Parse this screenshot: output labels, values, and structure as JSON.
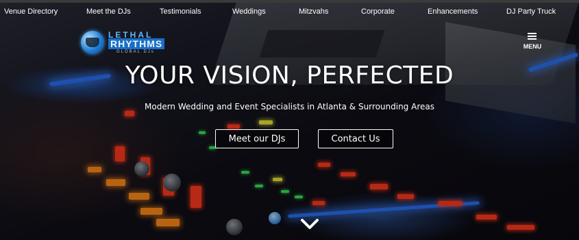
{
  "nav": {
    "items": [
      "Venue Directory",
      "Meet the DJs",
      "Testimonials",
      "Weddings",
      "Mitzvahs",
      "Corporate",
      "Enhancements",
      "DJ Party Truck"
    ]
  },
  "logo": {
    "line1": "LETHAL",
    "line2": "RHYTHMS",
    "line3": "GLOBAL DJs"
  },
  "menu": {
    "label": "MENU",
    "icon": "hamburger-icon"
  },
  "hero": {
    "headline": "YOUR VISION, PERFECTED",
    "subheadline": "Modern Wedding and Event Specialists in Atlanta & Surrounding Areas",
    "buttons": {
      "primary": "Meet our DJs",
      "secondary": "Contact Us"
    },
    "scroll_icon": "chevron-down-icon"
  },
  "colors": {
    "text": "#ffffff",
    "logo_blue": "#1a6fc4",
    "led_red": "#ff3a1e",
    "led_orange": "#ff8a1a"
  }
}
